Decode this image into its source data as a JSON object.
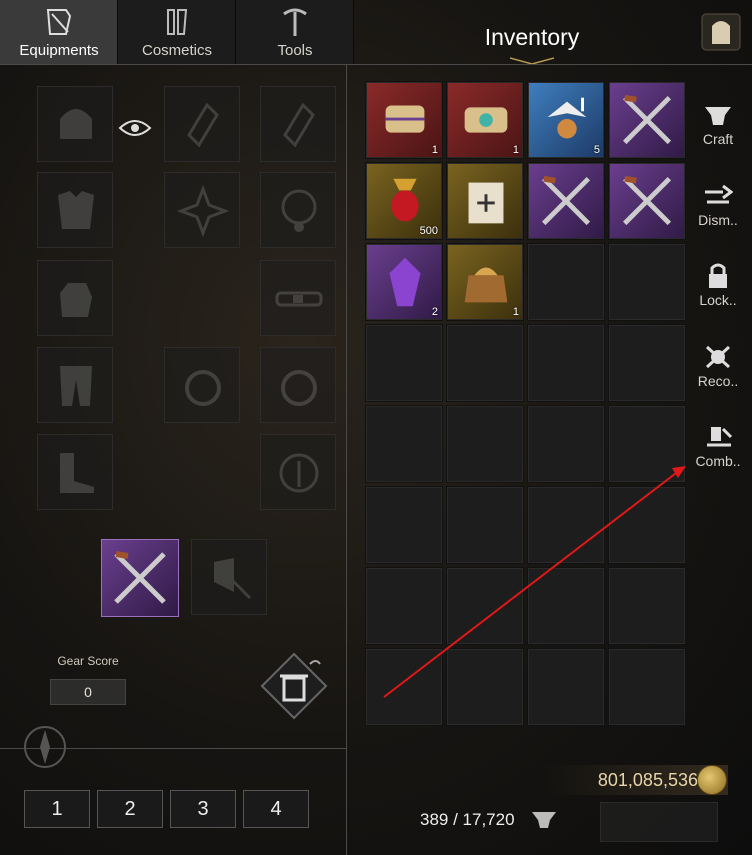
{
  "tabs": [
    {
      "label": "Equipments",
      "icon": "armor-scroll-icon",
      "active": true
    },
    {
      "label": "Cosmetics",
      "icon": "outfit-icon",
      "active": false
    },
    {
      "label": "Tools",
      "icon": "pickaxe-icon",
      "active": false
    }
  ],
  "inventory": {
    "title": "Inventory",
    "items": [
      {
        "name": "scroll-bundle",
        "qty": "1",
        "rarity": "red"
      },
      {
        "name": "gem-scroll",
        "qty": "1",
        "rarity": "red"
      },
      {
        "name": "winged-fairy",
        "qty": "5",
        "rarity": "blue"
      },
      {
        "name": "crossed-swords",
        "qty": "",
        "rarity": "purple"
      },
      {
        "name": "ruby-amulet",
        "qty": "500",
        "rarity": "gold"
      },
      {
        "name": "scroll-plus",
        "qty": "",
        "rarity": "gold"
      },
      {
        "name": "crossed-swords",
        "qty": "",
        "rarity": "purple"
      },
      {
        "name": "crossed-swords",
        "qty": "",
        "rarity": "purple"
      },
      {
        "name": "purple-crystal",
        "qty": "2",
        "rarity": "purple"
      },
      {
        "name": "treasure-pouch",
        "qty": "1",
        "rarity": "gold"
      }
    ]
  },
  "side_actions": [
    {
      "label": "Craft",
      "icon": "anvil-icon"
    },
    {
      "label": "Dism..",
      "icon": "dismantle-icon"
    },
    {
      "label": "Lock..",
      "icon": "lock-icon"
    },
    {
      "label": "Reco..",
      "icon": "recover-icon"
    },
    {
      "label": "Comb..",
      "icon": "combine-icon"
    }
  ],
  "gear_score": {
    "label": "Gear Score",
    "value": "0"
  },
  "presets": [
    "1",
    "2",
    "3",
    "4"
  ],
  "currency": {
    "gold": "801,085,536"
  },
  "weight": "389 / 17,720",
  "colors": {
    "accent_gold": "#e6d6a8",
    "arrow": "#e01818",
    "rarity_purple": "#6b3f8f",
    "rarity_red": "#8c2a2a",
    "rarity_blue": "#3f7fbf",
    "rarity_gold": "#7a6420"
  }
}
